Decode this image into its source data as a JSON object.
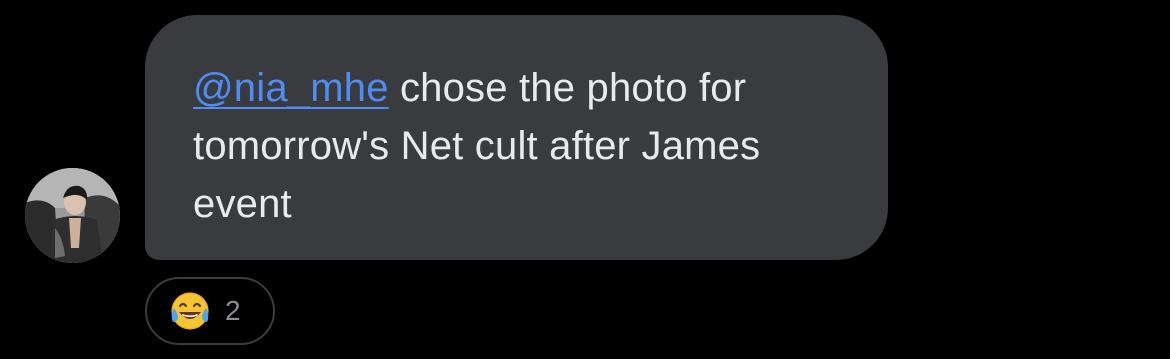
{
  "message": {
    "mention": "@nia_mhe",
    "text": " chose the photo for tomorrow's Net cult after James event"
  },
  "sender": {
    "avatar_icon": "person-photo-avatar"
  },
  "reaction": {
    "emoji_icon": "face-with-tears-of-joy-icon",
    "count": "2"
  },
  "colors": {
    "background": "#000000",
    "bubble": "#3a3b3f",
    "message_text": "#e9eaec",
    "mention_link": "#4f8cf5",
    "reaction_border": "#3c3c3f",
    "reaction_count": "#8b8d93"
  }
}
